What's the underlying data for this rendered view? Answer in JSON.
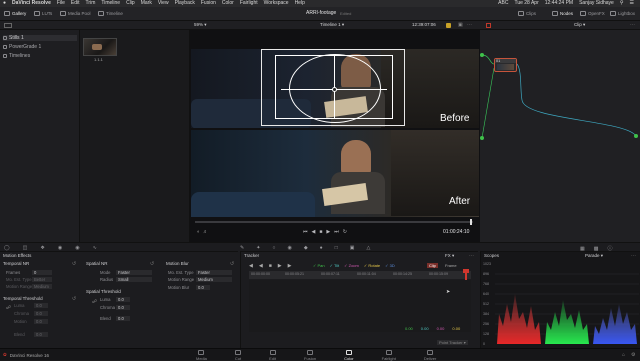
{
  "menubar": {
    "app": "DaVinci Resolve",
    "items": [
      "File",
      "Edit",
      "Trim",
      "Timeline",
      "Clip",
      "Mark",
      "View",
      "Playback",
      "Fusion",
      "Color",
      "Fairlight",
      "Workspace",
      "Help"
    ],
    "status": [
      "ABC",
      "Tue 28 Apr",
      "12:44:24 PM",
      "Sanjay Sidhaye"
    ]
  },
  "toolbar": {
    "left": [
      "Gallery",
      "LUTs",
      "Media Pool",
      "Timeline"
    ],
    "project": "ARRI-footage",
    "project_sub": "Edited",
    "right": [
      "Clips",
      "Nodes",
      "OpenFX",
      "Lightbox"
    ]
  },
  "subbar": {
    "zoom": "59%",
    "timeline": "Timeline 1",
    "timecode": "12:39:07:06",
    "node_mode": "Clip"
  },
  "gallery": {
    "items": [
      "Stills 1",
      "PowerGrade 1",
      "Timelines"
    ],
    "thumb_label": "1.1.1"
  },
  "viewer": {
    "top_label": "Before",
    "bottom_label": "After",
    "timecode": "01:00:24:10"
  },
  "node": {
    "label": "01"
  },
  "motion": {
    "title": "Motion Effects",
    "temporal_nr": "Temporal NR",
    "frames_label": "Frames",
    "frames_val": "0",
    "mo_est_label": "Mo. Est. Type",
    "mo_est_val": "Better",
    "motion_range_label": "Motion Range",
    "motion_range_val": "Medium",
    "temporal_threshold": "Temporal Threshold",
    "luma_label": "Luma",
    "chroma_label": "Chroma",
    "motion_label": "Motion",
    "blend_label": "Blend",
    "spatial_nr": "Spatial NR",
    "mode_label": "Mode",
    "mode_val": "Faster",
    "radius_label": "Radius",
    "radius_val": "Small",
    "spatial_threshold": "Spatial Threshold",
    "sp_luma_label": "Luma",
    "sp_luma_val": "0.0",
    "sp_chroma_label": "Chroma",
    "sp_chroma_val": "0.0",
    "sp_blend_label": "Blend",
    "sp_blend_val": "0.0",
    "motion_blur": "Motion Blur",
    "mb_est_label": "Mo. Est. Type",
    "mb_est_val": "Faster",
    "mb_range_label": "Motion Range",
    "mb_range_val": "Medium",
    "mb_blur_label": "Motion Blur",
    "mb_blur_val": "0.0",
    "greyed_val": "0.0"
  },
  "tracker": {
    "title": "Tracker",
    "fx": "FX",
    "frame": "Frame",
    "clip": "Clip",
    "toggles": [
      "Pan",
      "Tilt",
      "Zoom",
      "Rotate",
      "3D"
    ],
    "ruler": [
      "00:00:00:00",
      "00:00:05:21",
      "00:00:07:11",
      "00:00:11:04",
      "00:00:14:25",
      "00:00:15:09"
    ],
    "values": [
      "0.00",
      "0.00",
      "0.00",
      "0.00"
    ],
    "footer": "Point Tracker"
  },
  "scopes": {
    "title": "Scopes",
    "mode": "Parade",
    "scale": [
      "1023",
      "896",
      "768",
      "640",
      "512",
      "384",
      "256",
      "128",
      "0"
    ]
  },
  "pages": {
    "product": "DaVinci Resolve 16",
    "items": [
      "Media",
      "Cut",
      "Edit",
      "Fusion",
      "Color",
      "Fairlight",
      "Deliver"
    ],
    "active": "Color"
  },
  "colors": {
    "accent": "#d0372e",
    "green": "#3fc24a",
    "yellow": "#e6c84a",
    "teal": "#4fc7c0"
  }
}
